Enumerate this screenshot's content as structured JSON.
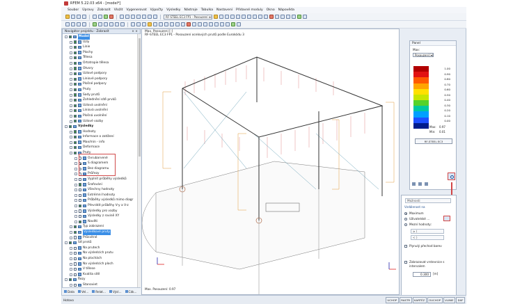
{
  "app": {
    "title": "RFEM 5.22.03 x64 - [model*]"
  },
  "menu": [
    "Soubor",
    "Úpravy",
    "Zobrazit",
    "Vložit",
    "Vygenerovat",
    "Výpočty",
    "Výsledky",
    "Nástroje",
    "Tabulka",
    "Nastavení",
    "Přídavné moduly",
    "Okno",
    "Nápověda"
  ],
  "toolbar": {
    "combo_label": "RF-STEEL EC3 FP1 - Posouzení ocelový"
  },
  "navigator": {
    "title": "Navigátor projektu - Zobrazit",
    "close_glyph": "× ×",
    "items": [
      {
        "indent": 0,
        "label": "Model",
        "checked": true,
        "bold": true,
        "highlight": true
      },
      {
        "indent": 1,
        "label": "Uzly",
        "checked": true
      },
      {
        "indent": 1,
        "label": "Linie",
        "checked": true
      },
      {
        "indent": 1,
        "label": "Plochy",
        "checked": true
      },
      {
        "indent": 1,
        "label": "Tělesa",
        "checked": true
      },
      {
        "indent": 1,
        "label": "Ortotropie tělesa",
        "checked": true
      },
      {
        "indent": 1,
        "label": "Otvory",
        "checked": true
      },
      {
        "indent": 1,
        "label": "Uzlové podpory",
        "checked": true
      },
      {
        "indent": 1,
        "label": "Liniové podpory",
        "checked": true
      },
      {
        "indent": 1,
        "label": "Plošné podpory",
        "checked": true
      },
      {
        "indent": 1,
        "label": "Pruty",
        "checked": true
      },
      {
        "indent": 1,
        "label": "Sady prutů",
        "checked": true
      },
      {
        "indent": 1,
        "label": "Zohlednění sítě prvků",
        "checked": true
      },
      {
        "indent": 1,
        "label": "Uzlová uvolnění",
        "checked": true
      },
      {
        "indent": 1,
        "label": "Liniová uvolnění",
        "checked": true
      },
      {
        "indent": 1,
        "label": "Plošná uvolnění",
        "checked": true
      },
      {
        "indent": 1,
        "label": "Uzlové vazby",
        "checked": true
      },
      {
        "indent": 0,
        "label": "Výsledky",
        "checked": true,
        "bold": true
      },
      {
        "indent": 1,
        "label": "Hodnoty",
        "checked": true
      },
      {
        "indent": 1,
        "label": "Informace o zatížení",
        "checked": true
      },
      {
        "indent": 1,
        "label": "Max/min - info",
        "checked": true
      },
      {
        "indent": 1,
        "label": "Deformace",
        "checked": true
      },
      {
        "indent": 1,
        "label": "Pruty",
        "checked": true
      },
      {
        "indent": 2,
        "label": "Ovrubarvené",
        "radio": true,
        "on": false
      },
      {
        "indent": 2,
        "label": "S diagramem",
        "radio": true,
        "on": true
      },
      {
        "indent": 2,
        "label": "Bez diagramu",
        "radio": true,
        "on": false
      },
      {
        "indent": 2,
        "label": "Průřezy",
        "radio": true,
        "on": false
      },
      {
        "indent": 2,
        "label": "Vyplnit průběhy výsledků",
        "checked": false
      },
      {
        "indent": 2,
        "label": "Šrafování",
        "checked": true
      },
      {
        "indent": 2,
        "label": "Všechny hodnoty",
        "checked": false
      },
      {
        "indent": 2,
        "label": "Extrémní hodnoty",
        "checked": false
      },
      {
        "indent": 2,
        "label": "Průběhy výsledků mimo diagr",
        "checked": false
      },
      {
        "indent": 2,
        "label": "Převrátit průběhy V-y a V-z",
        "checked": true
      },
      {
        "indent": 2,
        "label": "Výsledky pro vazby",
        "checked": false
      },
      {
        "indent": 2,
        "label": "Výsledky z rovině XY",
        "checked": false
      },
      {
        "indent": 2,
        "label": "Navěti",
        "checked": true
      },
      {
        "indent": 1,
        "label": "Typ zobrazení",
        "checked": true
      },
      {
        "indent": 1,
        "label": "Výsledkové pruty",
        "checked": true,
        "highlight": true
      },
      {
        "indent": 1,
        "label": "Průsvitné",
        "checked": false
      },
      {
        "indent": 0,
        "label": "Síť prvků",
        "checked": true
      },
      {
        "indent": 1,
        "label": "Na prutech",
        "checked": false
      },
      {
        "indent": 1,
        "label": "Na výsledcích prutu",
        "checked": false
      },
      {
        "indent": 1,
        "label": "Na plochách",
        "checked": false
      },
      {
        "indent": 1,
        "label": "Na výsledcích ploch",
        "checked": false
      },
      {
        "indent": 1,
        "label": "V tělese",
        "checked": false
      },
      {
        "indent": 1,
        "label": "Kvalita sítě",
        "checked": false
      },
      {
        "indent": 0,
        "label": "Řezy",
        "checked": true
      },
      {
        "indent": 1,
        "label": "Stanoviet",
        "checked": false
      }
    ],
    "tabs": [
      "Data",
      "Vel...",
      "Relat...",
      "Výsl...",
      "Cák..."
    ]
  },
  "view": {
    "header_line1": "Max. Posouzení [-]",
    "header_line2": "RF-STEEL EC3 FP1 - Posouzení ocelových prutů podle Eurokódu 3",
    "footer": "Max. Posouzení: 0.97"
  },
  "panel": {
    "title": "Panel",
    "max_label": "Max:",
    "select_value": "Posouzení [-]",
    "legend_values": [
      "1.00",
      "0.90",
      "0.80",
      "0.70",
      "0.60",
      "0.50",
      "0.40",
      "0.30",
      "0.20",
      "0.10",
      "0.00"
    ],
    "legend_colors": [
      "#b20000",
      "#e21212",
      "#ff5a00",
      "#ffa500",
      "#ffe000",
      "#c8e600",
      "#55d22a",
      "#00c8a0",
      "#00a0ff",
      "#1e50ff",
      "#001c8c"
    ],
    "max_value_label": "Max:",
    "max_value": "0.97",
    "min_value_label": "Min:",
    "min_value": "0.01",
    "module_button": "RF-STEEL EC3"
  },
  "options": {
    "header": "Možnosti",
    "section": "Vzdálenost na",
    "radio_max": "Maximum",
    "radio_user": "Uživatelské ...",
    "radio_limits": "Mezní hodnoty:",
    "from_placeholder": "≥ (",
    "to_placeholder": "< )",
    "checkbox_smooth": "Plynulý přechod barev",
    "checkbox_show": "Zobrazovat vrstevnice s",
    "checkbox_show2": "intervalem",
    "interval_value": "0.300",
    "interval_unit": "[m]"
  },
  "status": {
    "left": "Hotovo",
    "toggles": [
      "UCHOP",
      "RASTR",
      "KARTÉZ",
      "OUCHOP",
      "VLINIE",
      "DXF"
    ]
  }
}
